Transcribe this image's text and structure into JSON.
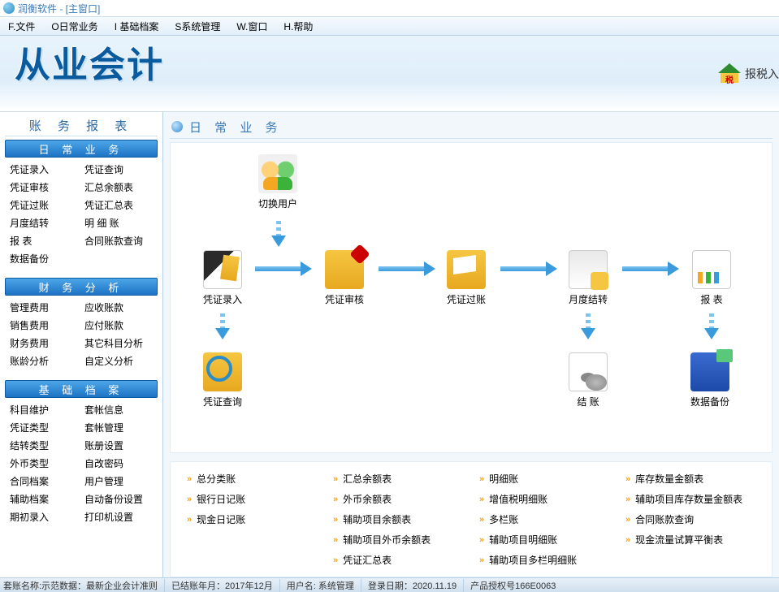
{
  "window": {
    "title": "润衡软件 - [主窗口]"
  },
  "menu": [
    "F.文件",
    "O日常业务",
    "I 基础档案",
    "S系统管理",
    "W.窗口",
    "H.帮助"
  ],
  "banner": {
    "title": "从业会计",
    "tax": "报税入",
    "tax_badge": "税"
  },
  "sidebar": {
    "title": "账 务 报 表",
    "groups": [
      {
        "head": "日 常 业 务",
        "rows": [
          [
            "凭证录入",
            "凭证查询"
          ],
          [
            "凭证审核",
            "汇总余额表"
          ],
          [
            "凭证过账",
            "凭证汇总表"
          ],
          [
            "月度结转",
            "明  细  账"
          ],
          [
            "报    表",
            "合同账款查询"
          ],
          [
            "数据备份",
            ""
          ]
        ]
      },
      {
        "head": "财 务 分 析",
        "rows": [
          [
            "管理费用",
            "应收账款"
          ],
          [
            "销售费用",
            "应付账款"
          ],
          [
            "财务费用",
            "其它科目分析"
          ],
          [
            "账龄分析",
            "自定义分析"
          ]
        ]
      },
      {
        "head": "基 础 档 案",
        "rows": [
          [
            "科目维护",
            "套帐信息"
          ],
          [
            "凭证类型",
            "套帐管理"
          ],
          [
            "结转类型",
            "账册设置"
          ],
          [
            "外币类型",
            "自改密码"
          ],
          [
            "合同档案",
            "用户管理"
          ],
          [
            "辅助档案",
            "自动备份设置"
          ],
          [
            "期初录入",
            "打印机设置"
          ]
        ]
      }
    ]
  },
  "content": {
    "title": "日 常 业 务",
    "nodes": {
      "switch": "切换用户",
      "entry": "凭证录入",
      "audit": "凭证审核",
      "post": "凭证过账",
      "month": "月度结转",
      "report": "报  表",
      "query": "凭证查询",
      "close": "结  账",
      "backup": "数据备份"
    },
    "links": [
      "总分类账",
      "汇总余额表",
      "明细账",
      "库存数量金额表",
      "银行日记账",
      "外币余额表",
      "增值税明细账",
      "辅助项目库存数量金额表",
      "现金日记账",
      "辅助项目余额表",
      "多栏账",
      "合同账款查询",
      "",
      "辅助项目外币余额表",
      "辅助项目明细账",
      "现金流量试算平衡表",
      "",
      "凭证汇总表",
      "辅助项目多栏明细账",
      ""
    ]
  },
  "status": {
    "acct": "套账名称:示范数据：最新企业会计准则",
    "period": "已结账年月：2017年12月",
    "user": "用户名: 系统管理",
    "login": "登录日期：2020.11.19",
    "lic": "产品授权号166E0063"
  }
}
